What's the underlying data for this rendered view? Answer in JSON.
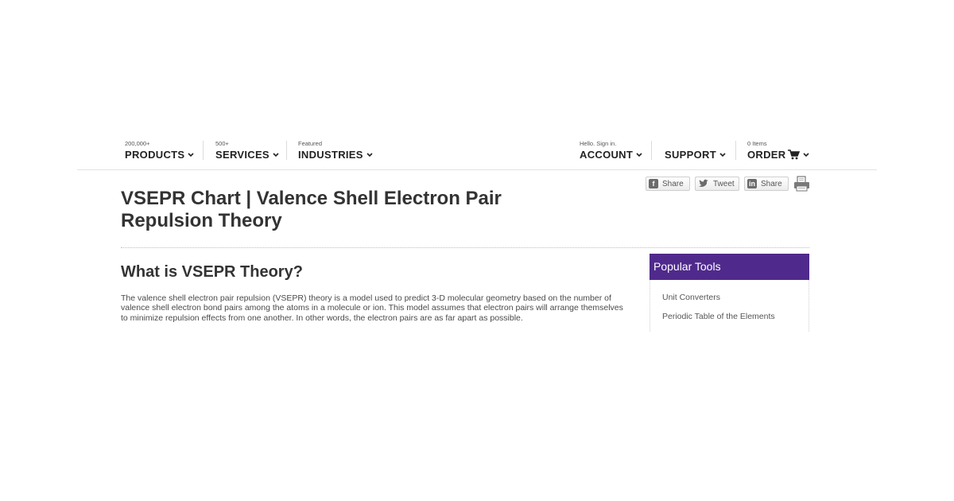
{
  "nav": {
    "products": {
      "small": "200,000+",
      "label": "PRODUCTS"
    },
    "services": {
      "small": "500+",
      "label": "SERVICES"
    },
    "industries": {
      "small": "Featured",
      "label": "INDUSTRIES"
    },
    "account": {
      "small": "Hello. Sign in.",
      "label": "ACCOUNT"
    },
    "support": {
      "small": "",
      "label": "SUPPORT"
    },
    "order": {
      "small": "0 Items",
      "label": "ORDER"
    }
  },
  "page_title": "VSEPR Chart | Valence Shell Electron Pair Repulsion Theory",
  "share": {
    "facebook": {
      "label": "Share",
      "icon": "facebook-icon"
    },
    "twitter": {
      "label": "Tweet",
      "icon": "twitter-icon"
    },
    "linkedin": {
      "label": "Share",
      "icon": "linkedin-icon"
    },
    "print_icon": "printer-icon"
  },
  "main": {
    "heading": "What is VSEPR Theory?",
    "paragraph": "The valence shell electron pair repulsion (VSEPR) theory is a model used to predict 3-D molecular geometry based on the number of valence shell electron bond pairs among the atoms in a molecule or ion. This model assumes that electron pairs will arrange themselves to minimize repulsion effects from one another. In other words, the electron pairs are as far apart as possible."
  },
  "sidebar": {
    "title": "Popular Tools",
    "links": [
      "Unit Converters",
      "Periodic Table of the Elements"
    ]
  },
  "colors": {
    "sidebar_header": "#4f2a8c",
    "text": "#333333"
  }
}
